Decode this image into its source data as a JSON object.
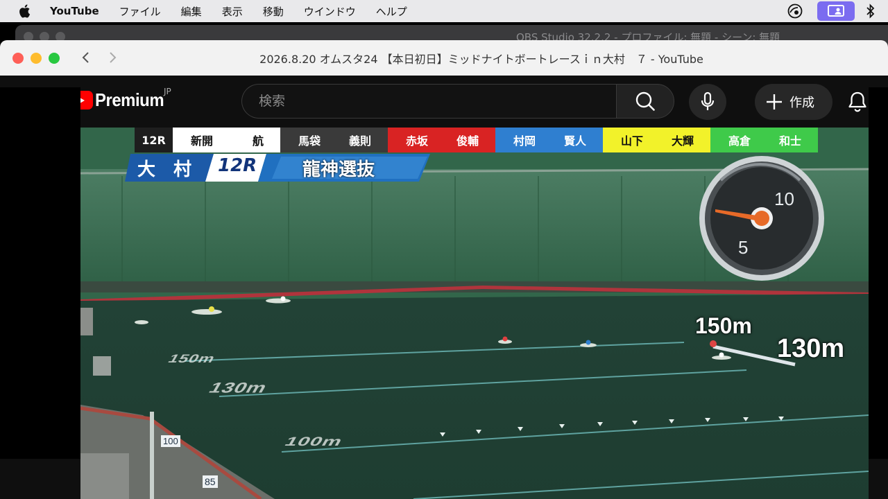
{
  "menubar": {
    "app": "YouTube",
    "items": [
      "ファイル",
      "編集",
      "表示",
      "移動",
      "ウインドウ",
      "ヘルプ"
    ]
  },
  "background_window": {
    "title": "OBS Studio 32.2.2 - プロファイル: 無題 - シーン: 無題"
  },
  "browser": {
    "title": "2026.8.20 オムスタ24 【本日初日】ミッドナイトボートレースｉｎ大村　７ - YouTube"
  },
  "yt": {
    "logo_text": "Premium",
    "country": "JP",
    "search_placeholder": "検索",
    "create_label": "作成"
  },
  "video": {
    "race": "12R",
    "lanes": [
      {
        "lane": 1,
        "surname": "新開",
        "given": "航",
        "bg": "#ffffff",
        "fg": "#111111"
      },
      {
        "lane": 2,
        "surname": "馬袋",
        "given": "義則",
        "bg": "#3a3a3a",
        "fg": "#ffffff"
      },
      {
        "lane": 3,
        "surname": "赤坂",
        "given": "俊輔",
        "bg": "#d92323",
        "fg": "#ffffff"
      },
      {
        "lane": 4,
        "surname": "村岡",
        "given": "賢人",
        "bg": "#2f7fd0",
        "fg": "#ffffff"
      },
      {
        "lane": 5,
        "surname": "山下",
        "given": "大輝",
        "bg": "#f2f22a",
        "fg": "#111111"
      },
      {
        "lane": 6,
        "surname": "高倉",
        "given": "和士",
        "bg": "#3fca4a",
        "fg": "#ffffff"
      }
    ],
    "venue": "大　村",
    "venue_race": "12R",
    "race_title": "龍神選抜",
    "clock_labels": [
      "10",
      "5"
    ],
    "clock_hand": "orange-hand",
    "distances": [
      "150m",
      "130m"
    ],
    "track_marks": [
      "150m",
      "130m",
      "100m"
    ],
    "buoy_numbers": [
      "100",
      "85"
    ]
  }
}
